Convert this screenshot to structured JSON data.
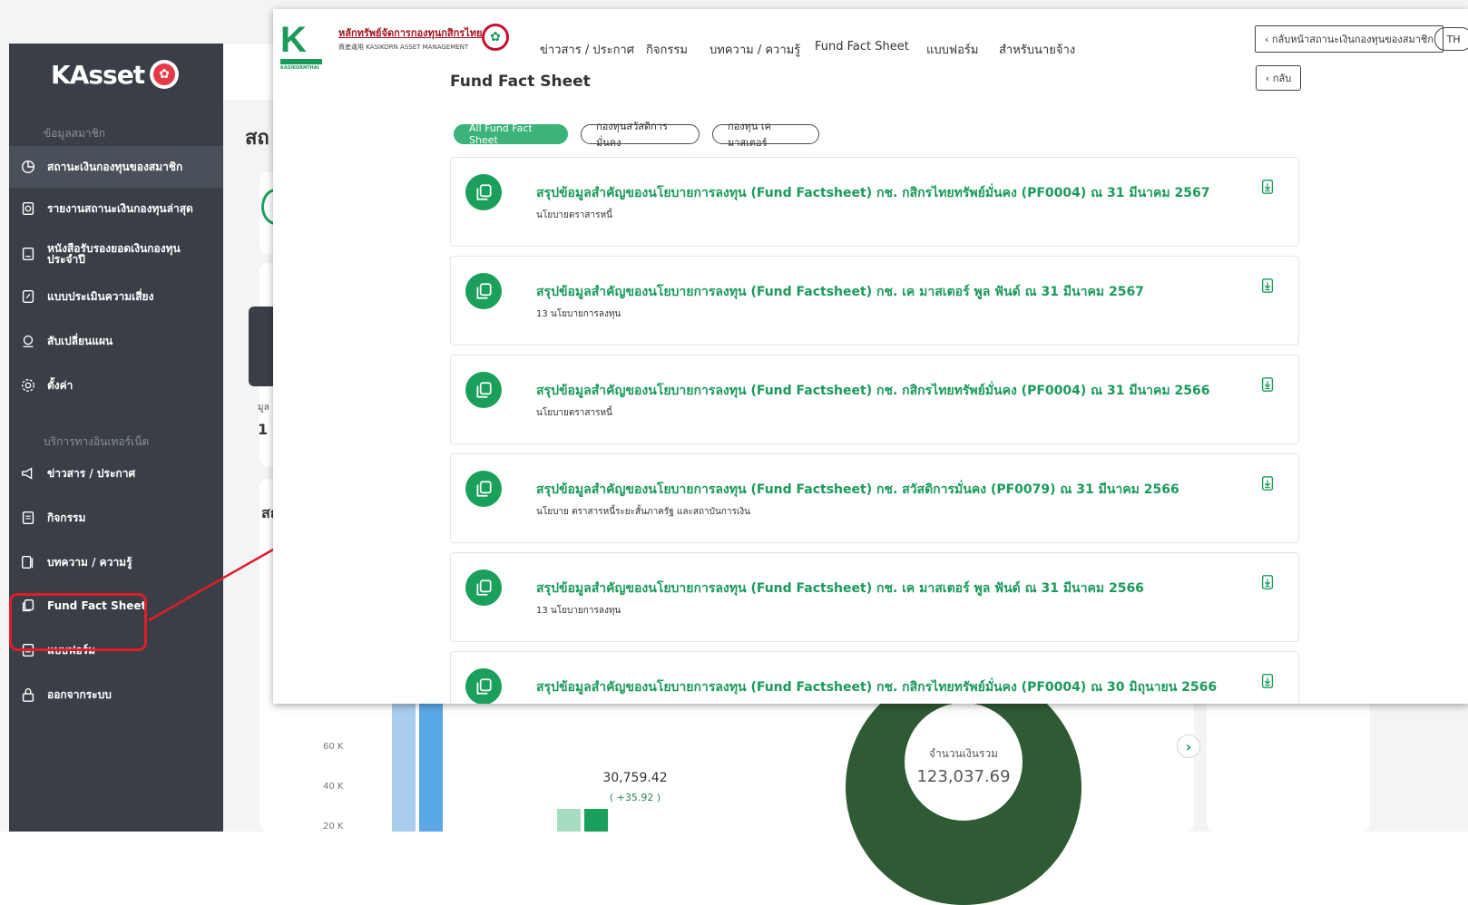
{
  "sidebar": {
    "logo_text": "KAsset",
    "section_member": "ข้อมูลสมาชิก",
    "section_internet": "บริการทางอินเทอร์เน็ต",
    "items": [
      {
        "label": "สถานะเงินกองทุนของสมาชิก",
        "icon": "pie-chart-icon"
      },
      {
        "label": "รายงานสถานะเงินกองทุนล่าสุด",
        "icon": "report-icon"
      },
      {
        "label": "หนังสือรับรองยอดเงินกองทุน ประจำปี",
        "icon": "certificate-icon"
      },
      {
        "label": "แบบประเมินความเสี่ยง",
        "icon": "risk-form-icon"
      },
      {
        "label": "สับเปลี่ยนแผน",
        "icon": "switch-plan-icon"
      },
      {
        "label": "ตั้งค่า",
        "icon": "gear-icon"
      },
      {
        "label": "ข่าวสาร / ประกาศ",
        "icon": "megaphone-icon"
      },
      {
        "label": "กิจกรรม",
        "icon": "activity-icon"
      },
      {
        "label": "บทความ / ความรู้",
        "icon": "article-icon"
      },
      {
        "label": "Fund Fact Sheet",
        "icon": "document-copy-icon"
      },
      {
        "label": "แบบฟอร์ม",
        "icon": "form-icon"
      },
      {
        "label": "ออกจากระบบ",
        "icon": "lock-icon"
      }
    ]
  },
  "background": {
    "partial_labels": [
      "สถ",
      "สถ",
      "มูล",
      "1"
    ],
    "y_ticks": [
      "60 K",
      "40 K",
      "20 K"
    ],
    "chart_value": "30,759.42",
    "chart_delta": "( +35.92 )",
    "donut_label": "จำนวนเงินรวม",
    "donut_value": "123,037.69"
  },
  "overlay": {
    "brand_th": "หลักทรัพย์จัดการกองทุนกสิกรไทย",
    "brand_en": "資産運用 KASIKORN ASSET MANAGEMENT",
    "brand_k_sub": "KASIKORNTHAI",
    "nav": [
      "ข่าวสาร / ประกาศ",
      "กิจกรรม",
      "บทความ / ความรู้",
      "Fund Fact Sheet",
      "แบบฟอร์ม",
      "สำหรับนายจ้าง"
    ],
    "back_member_label": "‹ กลับหน้าสถานะเงินกองทุนของสมาชิก",
    "lang_label": "TH",
    "back_label": "‹ กลับ",
    "page_title": "Fund Fact Sheet",
    "filters": [
      "All Fund Fact Sheet",
      "กองทุนสวัสดิการมั่นคง",
      "กองทุน เค มาสเตอร์"
    ],
    "funds": [
      {
        "title": "สรุปข้อมูลสำคัญของนโยบายการลงทุน (Fund Factsheet) กช. กสิกรไทยทรัพย์มั่นคง (PF0004) ณ 31 มีนาคม 2567",
        "subtitle": "นโยบายตราสารหนี้"
      },
      {
        "title": "สรุปข้อมูลสำคัญของนโยบายการลงทุน (Fund Factsheet) กช. เค มาสเตอร์ พูล ฟันด์ ณ 31 มีนาคม 2567",
        "subtitle": "13 นโยบายการลงทุน"
      },
      {
        "title": "สรุปข้อมูลสำคัญของนโยบายการลงทุน (Fund Factsheet) กช. กสิกรไทยทรัพย์มั่นคง (PF0004) ณ 31 มีนาคม 2566",
        "subtitle": "นโยบายตราสารหนี้"
      },
      {
        "title": "สรุปข้อมูลสำคัญของนโยบายการลงทุน (Fund Factsheet) กช. สวัสดิการมั่นคง (PF0079) ณ 31 มีนาคม 2566",
        "subtitle": "นโยบาย ตราสารหนี้ระยะสั้นภาครัฐ และสถาบันการเงิน"
      },
      {
        "title": "สรุปข้อมูลสำคัญของนโยบายการลงทุน (Fund Factsheet) กช. เค มาสเตอร์ พูล ฟันด์ ณ 31 มีนาคม 2566",
        "subtitle": "13 นโยบายการลงทุน"
      },
      {
        "title": "สรุปข้อมูลสำคัญของนโยบายการลงทุน (Fund Factsheet) กช. กสิกรไทยทรัพย์มั่นคง (PF0004) ณ 30 มิถุนายน 2566",
        "subtitle": ""
      }
    ]
  },
  "colors": {
    "brand_green": "#1a9a5a",
    "sidebar_bg": "#3a3f47",
    "highlight_red": "#e11d2a",
    "active_filter": "#3bb37a"
  }
}
